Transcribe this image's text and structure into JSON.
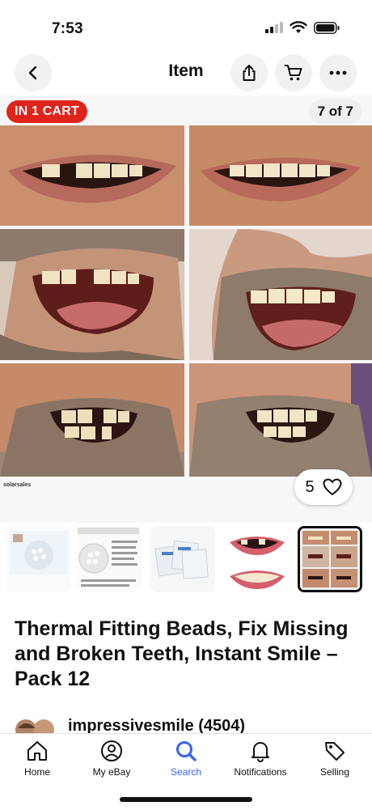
{
  "status_bar": {
    "time": "7:53"
  },
  "header": {
    "title": "Item",
    "icons": [
      "back-icon",
      "share-icon",
      "cart-icon",
      "more-icon"
    ]
  },
  "gallery": {
    "cart_badge": "IN 1 CART",
    "image_counter": "7 of 7",
    "seller_watermark": "solarsales",
    "like_count": "5"
  },
  "thumbnails": {
    "count": 5,
    "selected_index": 4,
    "thumb1_texts": [
      "Thermal Fitting Beads",
      "Soften in Hot Water"
    ],
    "thumb2_texts": [
      "Fitting Instructions",
      "Used for temporary teeth repair"
    ]
  },
  "item": {
    "title": "Thermal Fitting Beads, Fix Missing and Broken Teeth, Instant Smile –Pack 12",
    "seller": "impressivesmile (4504)"
  },
  "tab_bar": {
    "items": [
      {
        "label": "Home",
        "icon": "home-icon"
      },
      {
        "label": "My eBay",
        "icon": "profile-icon"
      },
      {
        "label": "Search",
        "icon": "search-icon"
      },
      {
        "label": "Notifications",
        "icon": "bell-icon"
      },
      {
        "label": "Selling",
        "icon": "tag-icon"
      }
    ],
    "active": "Search"
  },
  "colors": {
    "accent": "#3665f3",
    "badge_red": "#e0241b"
  }
}
